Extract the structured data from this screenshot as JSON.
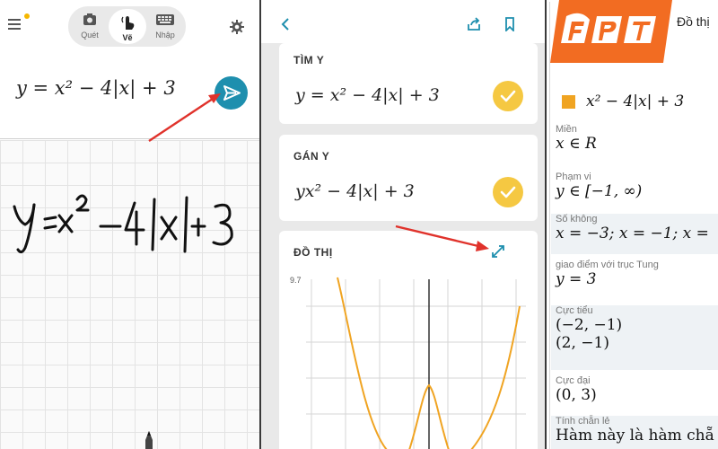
{
  "left_panel": {
    "modes": [
      {
        "label": "Quét",
        "icon": "camera-icon"
      },
      {
        "label": "Vẽ",
        "icon": "hand-draw-icon"
      },
      {
        "label": "Nhập",
        "icon": "keyboard-icon"
      }
    ],
    "active_mode": "Vẽ",
    "equation": "y = x² − 4|x| + 3",
    "handwriting": "y=x²−4|x|+3"
  },
  "middle_panel": {
    "cards": [
      {
        "title": "TÌM Y",
        "equation": "y = x² − 4|x| + 3"
      },
      {
        "title": "GÁN Y",
        "equation": "yx² − 4|x| + 3"
      }
    ],
    "graph_title": "ĐỒ THỊ",
    "graph_y_label": "9.7",
    "icons": [
      "back-icon",
      "share-icon",
      "bookmark-icon",
      "expand-icon"
    ]
  },
  "right_panel": {
    "tab_label": "Đồ thị",
    "brand_logo": "FPT",
    "series_label": "x² − 4|x| + 3",
    "series_color": "#f0a422",
    "rows": [
      {
        "label": "Miền",
        "values": [
          "x ∈ R"
        ]
      },
      {
        "label": "Phạm vi",
        "values": [
          "y ∈ [−1, ∞)"
        ]
      },
      {
        "label": "Số không",
        "values": [
          "x = −3; x = −1; x ="
        ]
      },
      {
        "label": "giao điểm với trục Tung",
        "values": [
          "y = 3"
        ]
      },
      {
        "label": "Cực tiểu",
        "values": [
          "(−2, −1)",
          "(2, −1)"
        ]
      },
      {
        "label": "Cực đại",
        "values": [
          "(0, 3)"
        ]
      },
      {
        "label": "Tính chẵn lẻ",
        "values": [
          "Hàm này là hàm chẵ"
        ]
      }
    ]
  },
  "colors": {
    "accent_teal": "#1e8fae",
    "check_yellow": "#f5c842",
    "graph_line": "#f0a422",
    "arrow_red": "#e0322b",
    "fpt_orange": "#f26c22"
  }
}
